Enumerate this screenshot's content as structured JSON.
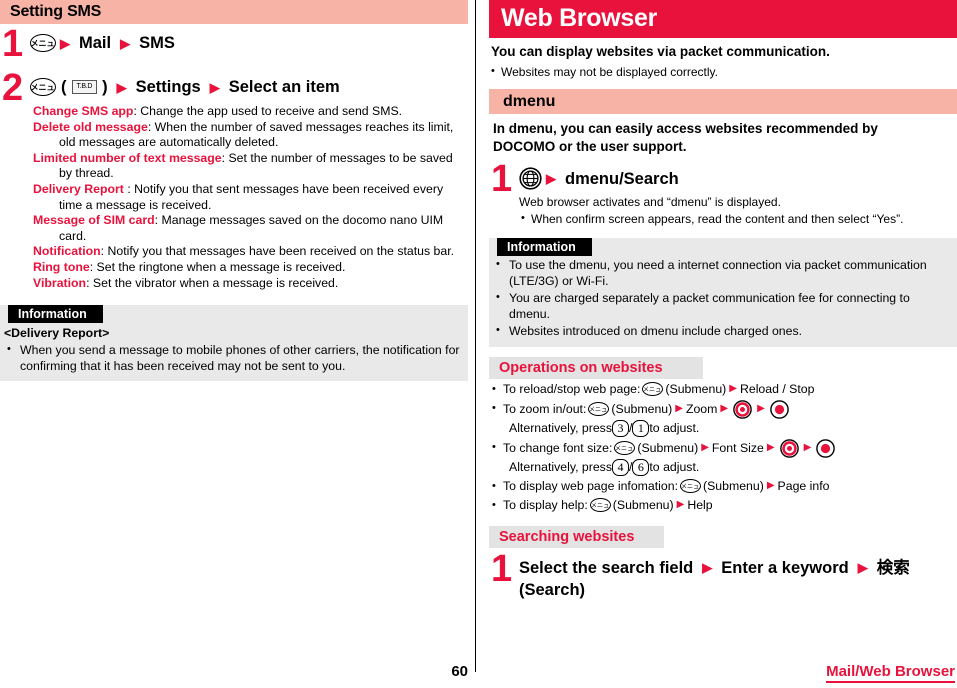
{
  "left": {
    "section_title": "Setting SMS",
    "step1": {
      "number": "1",
      "menu_key": "menu-key-icon",
      "parts": [
        "Mail",
        "SMS"
      ]
    },
    "step2": {
      "number": "2",
      "menu_key": "menu-key-icon",
      "tbd_label": "T.B.D",
      "paren_open": "(",
      "paren_close": ")",
      "parts": [
        "Settings",
        "Select an item"
      ]
    },
    "options": [
      {
        "name": "Change SMS app",
        "sep": ":",
        "desc": " Change the app used to receive and send SMS."
      },
      {
        "name": "Delete old message",
        "sep": ":",
        "desc": " When the number of saved messages reaches its limit, old messages are automatically deleted."
      },
      {
        "name": "Limited number of text message",
        "sep": ":",
        "desc": " Set the number of messages to be saved by thread."
      },
      {
        "name": "Delivery Report",
        "sep": " :",
        "desc": " Notify you that sent messages have been received every time a message is received."
      },
      {
        "name": "Message of SIM card",
        "sep": ":",
        "desc": " Manage messages saved on the docomo nano UIM card."
      },
      {
        "name": "Notification",
        "sep": ":",
        "desc": " Notify you that messages have been received on the status bar."
      },
      {
        "name": "Ring tone",
        "sep": ":",
        "desc": " Set the ringtone when a message is received."
      },
      {
        "name": "Vibration",
        "sep": ":",
        "desc": " Set the vibrator when a message is received."
      }
    ],
    "information": {
      "tag": "Information",
      "subtitle": "<Delivery Report>",
      "bullets": [
        "When you send a message to mobile phones of other carriers, the notification for confirming that it has been received may not be sent to you."
      ]
    }
  },
  "right": {
    "title": "Web Browser",
    "lead": "You can display websites via packet communication.",
    "lead_bullet": "Websites may not be displayed correctly.",
    "dmenu": {
      "heading": "dmenu",
      "intro_line1": "In dmenu, you can easily access websites recommended by",
      "intro_line2": "DOCOMO or the user support.",
      "step": {
        "number": "1",
        "globe_key": "globe-key-icon",
        "label": "dmenu/Search",
        "sub": "Web browser activates and “dmenu” is displayed.",
        "sub_bullet": "When confirm screen appears, read the content and then select “Yes”."
      },
      "information": {
        "tag": "Information",
        "bullets": [
          "To use the dmenu, you need a internet connection via packet communication (LTE/3G) or Wi-Fi.",
          "You are charged separately a packet communication fee for connecting to dmenu.",
          "Websites introduced on dmenu include charged ones."
        ]
      }
    },
    "operations": {
      "heading": "Operations on websites",
      "rows": [
        {
          "id": "reload-stop",
          "lead": "To reload/stop web page: ",
          "submenu": "(Submenu)",
          "tail": "Reload / Stop"
        },
        {
          "id": "zoom-in-out",
          "lead": "To zoom in/out: ",
          "submenu": "(Submenu)",
          "mid": "Zoom",
          "alt_prefix": "Alternatively, press ",
          "alt_key1": "3",
          "alt_slash": "/",
          "alt_key2": "1",
          "alt_suffix": " to adjust."
        },
        {
          "id": "font-size",
          "lead": "To change font size: ",
          "submenu": "(Submenu)",
          "mid": "Font Size",
          "alt_prefix": "Alternatively, press ",
          "alt_key1": "4",
          "alt_slash": "/",
          "alt_key2": "6",
          "alt_suffix": " to adjust."
        },
        {
          "id": "page-info",
          "lead": "To display web page infomation: ",
          "submenu": "(Submenu)",
          "tail": "Page info"
        },
        {
          "id": "help",
          "lead": "To display help: ",
          "submenu": "(Submenu)",
          "tail": "Help"
        }
      ]
    },
    "searching": {
      "heading": "Searching websites",
      "step": {
        "number": "1",
        "part1": "Select the search field",
        "part2": "Enter a keyword",
        "part3": "検索",
        "part4": "(Search)"
      }
    }
  },
  "footer": {
    "page_number": "60",
    "section": "Mail/Web Browser"
  },
  "colors": {
    "accent_red": "#e8123c",
    "heading_pink": "#f7b3a6",
    "heading_gray": "#e3e3e3",
    "info_bg": "#e9e9e9"
  }
}
